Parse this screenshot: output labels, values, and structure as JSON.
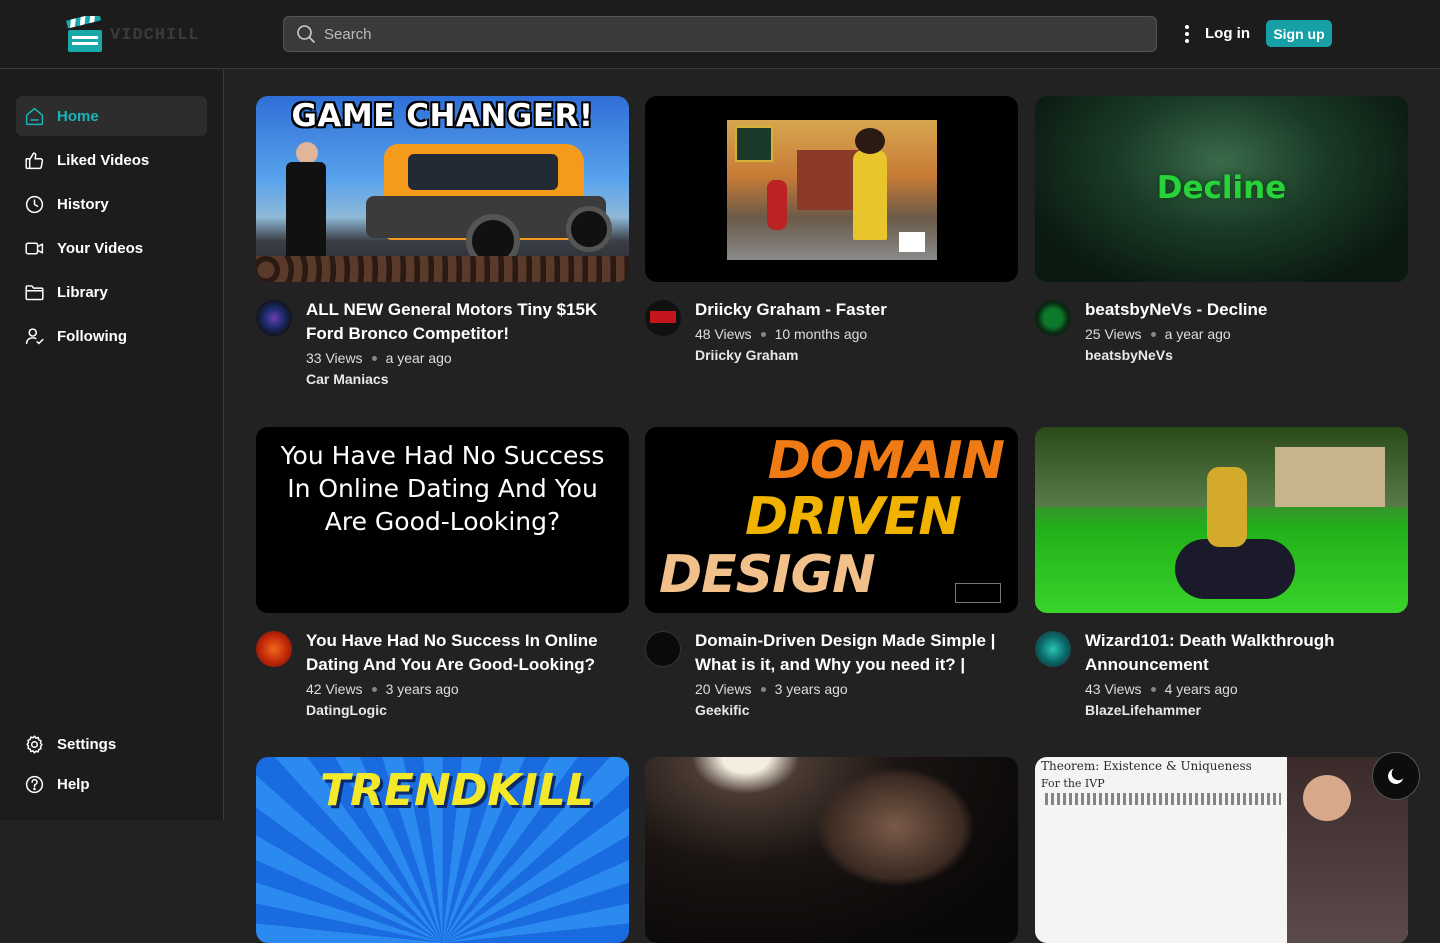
{
  "header": {
    "logo_text": "VIDCHILL",
    "search_placeholder": "Search",
    "login_label": "Log in",
    "signup_label": "Sign up"
  },
  "sidebar": {
    "items": [
      {
        "label": "Home",
        "icon": "home-icon",
        "active": true
      },
      {
        "label": "Liked Videos",
        "icon": "thumbs-up-icon"
      },
      {
        "label": "History",
        "icon": "history-icon"
      },
      {
        "label": "Your Videos",
        "icon": "video-camera-icon"
      },
      {
        "label": "Library",
        "icon": "folder-icon"
      },
      {
        "label": "Following",
        "icon": "user-check-icon"
      }
    ],
    "bottom": [
      {
        "label": "Settings",
        "icon": "gear-icon"
      },
      {
        "label": "Help",
        "icon": "help-icon"
      }
    ]
  },
  "videos": [
    {
      "title": "ALL NEW General Motors Tiny $15K Ford Bronco Competitor!",
      "views": "33 Views",
      "age": "a year ago",
      "channel": "Car Maniacs",
      "thumb_text": "GAME CHANGER!"
    },
    {
      "title": "Driicky Graham - Faster",
      "views": "48 Views",
      "age": "10 months ago",
      "channel": "Driicky Graham",
      "thumb_text": ""
    },
    {
      "title": "beatsbyNeVs - Decline",
      "views": "25 Views",
      "age": "a year ago",
      "channel": "beatsbyNeVs",
      "thumb_text": "Decline"
    },
    {
      "title": "You Have Had No Success In Online Dating And You Are Good-Looking?",
      "views": "42 Views",
      "age": "3 years ago",
      "channel": "DatingLogic",
      "thumb_text": "You Have Had No Success In Online Dating And You Are Good-Looking?"
    },
    {
      "title": "Domain-Driven Design Made Simple | What is it, and Why you need it? |",
      "views": "20 Views",
      "age": "3 years ago",
      "channel": "Geekific",
      "thumb_text": [
        "DOMAIN",
        "DRIVEN",
        "DESIGN"
      ]
    },
    {
      "title": "Wizard101: Death Walkthrough Announcement",
      "views": "43 Views",
      "age": "4 years ago",
      "channel": "BlazeLifehammer",
      "thumb_text": ""
    }
  ],
  "partial_thumbs": [
    {
      "thumb_text": "TRENDKILL"
    },
    {
      "thumb_text": ""
    },
    {
      "thumb_text": "Theorem: Existence & Uniqueness",
      "sub_text": "For the IVP"
    }
  ],
  "colors": {
    "accent": "#16a0a6",
    "active_nav": "#19b3b8",
    "background": "#222222"
  }
}
